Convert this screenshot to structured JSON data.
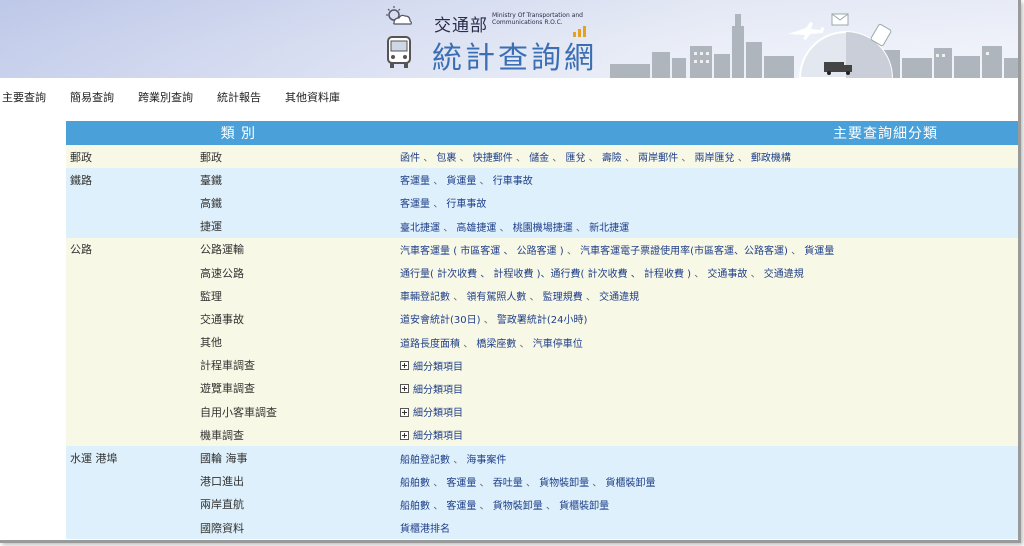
{
  "header": {
    "ministry_cn": "交通部",
    "ministry_en": "Ministry Of Transportation and Communications R.O.C.",
    "title": "統計查詢網"
  },
  "menu": [
    "主要查詢",
    "簡易查詢",
    "跨業別查詢",
    "統計報告",
    "其他資料庫"
  ],
  "table": {
    "header_category": "類 別",
    "header_subcategory": "主要查詢細分類",
    "expand_label": "細分類項目",
    "rows": [
      {
        "group": "郵政",
        "category": "郵政",
        "items": [
          "函件",
          "包裹",
          "快捷郵件",
          "儲金",
          "匯兌",
          "壽險",
          "兩岸郵件",
          "兩岸匯兌",
          "郵政機構"
        ],
        "style": "yellow"
      },
      {
        "group": "鐵路",
        "category": "臺鐵",
        "items": [
          "客運量",
          "貨運量",
          "行車事故"
        ],
        "style": "blue"
      },
      {
        "group": "",
        "category": "高鐵",
        "items": [
          "客運量",
          "行車事故"
        ],
        "style": "blue"
      },
      {
        "group": "",
        "category": "捷運",
        "items": [
          "臺北捷運",
          "高雄捷運",
          "桃園機場捷運",
          "新北捷運"
        ],
        "style": "blue"
      },
      {
        "group": "公路",
        "category": "公路運輸",
        "items": [
          "汽車客運量 ( 市區客運 、 公路客運 )",
          "汽車客運電子票證使用率(市區客運、公路客運)",
          "貨運量"
        ],
        "style": "yellow"
      },
      {
        "group": "",
        "category": "高速公路",
        "items": [
          "通行量( 計次收費 、 計程收費 )、通行費( 計次收費 、 計程收費 )",
          "交通事故",
          "交通違規"
        ],
        "style": "yellow"
      },
      {
        "group": "",
        "category": "監理",
        "items": [
          "車輛登記數",
          "領有駕照人數",
          "監理規費",
          "交通違規"
        ],
        "style": "yellow"
      },
      {
        "group": "",
        "category": "交通事故",
        "items": [
          "道安會統計(30日)",
          "警政署統計(24小時)"
        ],
        "style": "yellow"
      },
      {
        "group": "",
        "category": "其他",
        "items": [
          "道路長度面積",
          "橋梁座數",
          "汽車停車位"
        ],
        "style": "yellow"
      },
      {
        "group": "",
        "category": "計程車調查",
        "expand": true,
        "style": "yellow"
      },
      {
        "group": "",
        "category": "遊覽車調查",
        "expand": true,
        "style": "yellow"
      },
      {
        "group": "",
        "category": "自用小客車調查",
        "expand": true,
        "style": "yellow"
      },
      {
        "group": "",
        "category": "機車調查",
        "expand": true,
        "style": "yellow"
      },
      {
        "group": "水運 港埠",
        "category": "國輪 海事",
        "items": [
          "船舶登記數",
          "海事案件"
        ],
        "style": "blue"
      },
      {
        "group": "",
        "category": "港口進出",
        "items": [
          "船舶數",
          "客運量",
          "吞吐量",
          "貨物裝卸量",
          "貨櫃裝卸量"
        ],
        "style": "blue"
      },
      {
        "group": "",
        "category": "兩岸直航",
        "items": [
          "船舶數",
          "客運量",
          "貨物裝卸量",
          "貨櫃裝卸量"
        ],
        "style": "blue"
      },
      {
        "group": "",
        "category": "國際資料",
        "items": [
          "貨櫃港排名"
        ],
        "style": "blue"
      }
    ]
  },
  "colors": {
    "header_blue": "#4aa0d8",
    "row_yellow": "#f8f8e6",
    "row_blue": "#def0fb",
    "title_blue": "#3a6fb3"
  },
  "icons": [
    "weather-icon",
    "bus-icon",
    "chart-icon",
    "airplane-icon",
    "mail-icon",
    "luggage-icon",
    "truck-icon",
    "expand-icon"
  ]
}
